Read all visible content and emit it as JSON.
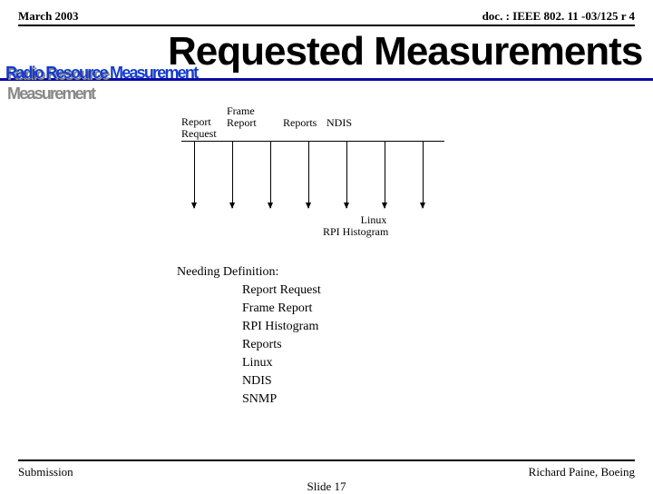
{
  "header": {
    "date": "March 2003",
    "docnum": "doc. : IEEE 802. 11 -03/125 r 4"
  },
  "title": "Requested Measurements",
  "wordart": "Radio Resource Measurement",
  "arrows": {
    "labels": {
      "report_request": "Report\nRequest",
      "frame_report": "Frame\nReport",
      "reports": "Reports",
      "ndis": "NDIS"
    }
  },
  "outputs": {
    "linux": "Linux",
    "rpi": "RPI Histogram"
  },
  "definition": {
    "heading": "Needing Definition:",
    "items": [
      "Report Request",
      "Frame Report",
      "RPI Histogram",
      "Reports",
      "Linux",
      "NDIS",
      "SNMP"
    ]
  },
  "footer": {
    "left": "Submission",
    "center": "Slide 17",
    "right": "Richard Paine, Boeing"
  }
}
